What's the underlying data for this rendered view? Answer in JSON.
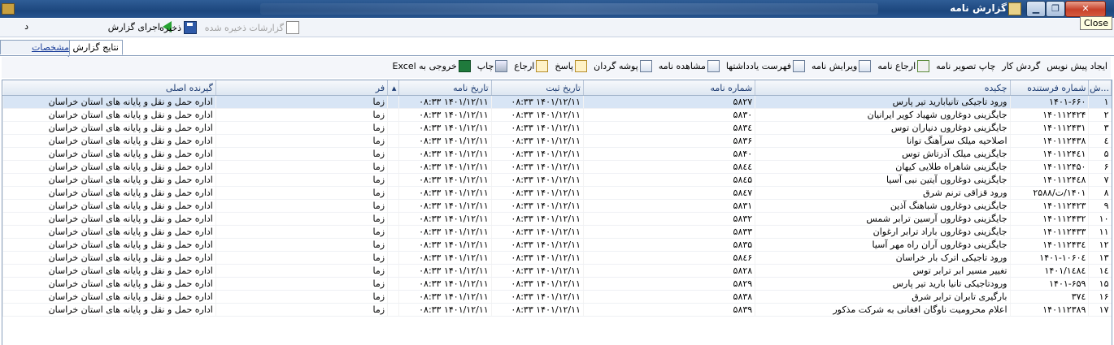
{
  "window": {
    "title": "گزارش نامه",
    "minimize": "▁",
    "maximize": "❐",
    "close": "✕",
    "close_tooltip": "Close"
  },
  "toolbar1": {
    "partial_left": "د",
    "run_report": "اجرای گزارش",
    "save": "ذخیره",
    "saved_reports": "گزارشات ذخیره شده"
  },
  "tabs": {
    "specs": "مشخصات گزارش",
    "results": "نتایج گزارش"
  },
  "actions": [
    {
      "label": "خروجی به Excel",
      "icon": "excel-icon"
    },
    {
      "label": "چاپ",
      "icon": "printer-icon"
    },
    {
      "label": "ارجاع",
      "icon": "mail-icon"
    },
    {
      "label": "پاسخ",
      "icon": "reply-mail-icon"
    },
    {
      "label": "پوشه گردان",
      "icon": "chart-icon"
    },
    {
      "label": "مشاهده نامه",
      "icon": "view-icon"
    },
    {
      "label": "فهرست یادداشتها",
      "icon": "list-icon"
    },
    {
      "label": "ویرایش نامه",
      "icon": "edit-icon"
    },
    {
      "label": "ارجاع نامه",
      "icon": "check-icon"
    },
    {
      "label": "چاپ تصویر نامه",
      "icon": ""
    },
    {
      "label": "گردش کار",
      "icon": ""
    },
    {
      "label": "ایجاد پیش نویس",
      "icon": ""
    }
  ],
  "columns": [
    "...ش",
    "شماره فرستنده",
    "چکیده",
    "شماره نامه",
    "تاریخ ثبت",
    "تاریخ نامه",
    "▴",
    "فر",
    "گیرنده اصلی"
  ],
  "rows": [
    {
      "n": "۱",
      "sender": "۱۴۰۱-۶۶۰",
      "summary": "ورود تاجیکی تانیابارید تیر پارس",
      "letter": "۵۸۲۷",
      "reg": "۱۴۰۱/۱۲/۱۱ ۰۸:۳۳",
      "date": "۱۴۰۱/۱۲/۱۱ ۰۸:۳۳",
      "fr": "زما",
      "recv": "اداره حمل و نقل و پایانه های استان خراسان"
    },
    {
      "n": "۲",
      "sender": "۱۴۰۱۱۲۴۲۴",
      "summary": "جایگزینی دوغاروں شهیاد کویر ایرانیان",
      "letter": "۵۸۳۰",
      "reg": "۱۴۰۱/۱۲/۱۱ ۰۸:۳۳",
      "date": "۱۴۰۱/۱۲/۱۱ ۰۸:۳۳",
      "fr": "زما",
      "recv": "اداره حمل و نقل و پایانه های استان خراسان"
    },
    {
      "n": "۳",
      "sender": "۱۴۰۱۱۲۴۳۱",
      "summary": "جایگزینی دوغاروں دنیاران توس",
      "letter": "۵۸۳٤",
      "reg": "۱۴۰۱/۱۲/۱۱ ۰۸:۳۳",
      "date": "۱۴۰۱/۱۲/۱۱ ۰۸:۳۳",
      "fr": "زما",
      "recv": "اداره حمل و نقل و پایانه های استان خراسان"
    },
    {
      "n": "٤",
      "sender": "۱۴۰۱۱۲۴۳۸",
      "summary": "اصلاحیه میلک سرآهنگ توانا",
      "letter": "۵۸۳۶",
      "reg": "۱۴۰۱/۱۲/۱۱ ۰۸:۳۳",
      "date": "۱۴۰۱/۱۲/۱۱ ۰۸:۳۳",
      "fr": "زما",
      "recv": "اداره حمل و نقل و پایانه های استان خراسان"
    },
    {
      "n": "۵",
      "sender": "۱۴۰۱۱۲۴٤۱",
      "summary": "جایگزینی میلک آذرتاش توس",
      "letter": "۵۸۴۰",
      "reg": "۱۴۰۱/۱۲/۱۱ ۰۸:۳۳",
      "date": "۱۴۰۱/۱۲/۱۱ ۰۸:۳۳",
      "fr": "زما",
      "recv": "اداره حمل و نقل و پایانه های استان خراسان"
    },
    {
      "n": "۶",
      "sender": "۱۴۰۱۱۲۴۵۰",
      "summary": "جایگزینی شاهراه طلایی کیهان",
      "letter": "۵۸٤٤",
      "reg": "۱۴۰۱/۱۲/۱۱ ۰۸:۳۳",
      "date": "۱۴۰۱/۱۲/۱۱ ۰۸:۳۳",
      "fr": "زما",
      "recv": "اداره حمل و نقل و پایانه های استان خراسان"
    },
    {
      "n": "۷",
      "sender": "۱۴۰۱۱۲۴٤۸",
      "summary": "جایگزینی دوغاروں آیتین نبی آسیا",
      "letter": "۵۸٤۵",
      "reg": "۱۴۰۱/۱۲/۱۱ ۰۸:۳۳",
      "date": "۱۴۰۱/۱۲/۱۱ ۰۸:۳۳",
      "fr": "زما",
      "recv": "اداره حمل و نقل و پایانه های استان خراسان"
    },
    {
      "n": "۸",
      "sender": "۱۴۰۱/ت/۲۵۸۸",
      "summary": "ورود قزاقی ترنم شرق",
      "letter": "۵۸٤۷",
      "reg": "۱۴۰۱/۱۲/۱۱ ۰۸:۳۳",
      "date": "۱۴۰۱/۱۲/۱۱ ۰۸:۳۳",
      "fr": "زما",
      "recv": "اداره حمل و نقل و پایانه های استان خراسان"
    },
    {
      "n": "۹",
      "sender": "۱۴۰۱۱۲۴۲۳",
      "summary": "جایگزینی دوغاروں شباهنگ آذین",
      "letter": "۵۸۳۱",
      "reg": "۱۴۰۱/۱۲/۱۱ ۰۸:۳۳",
      "date": "۱۴۰۱/۱۲/۱۱ ۰۸:۳۳",
      "fr": "زما",
      "recv": "اداره حمل و نقل و پایانه های استان خراسان"
    },
    {
      "n": "۱۰",
      "sender": "۱۴۰۱۱۲۴۳۲",
      "summary": "جایگزینی دوغاروں آرسین ترابر شمس",
      "letter": "۵۸۳۲",
      "reg": "۱۴۰۱/۱۲/۱۱ ۰۸:۳۳",
      "date": "۱۴۰۱/۱۲/۱۱ ۰۸:۳۳",
      "fr": "زما",
      "recv": "اداره حمل و نقل و پایانه های استان خراسان"
    },
    {
      "n": "۱۱",
      "sender": "۱۴۰۱۱۲۴۳۳",
      "summary": "جایگزینی دوغاروں باراد ترابر ارغوان",
      "letter": "۵۸۳۳",
      "reg": "۱۴۰۱/۱۲/۱۱ ۰۸:۳۳",
      "date": "۱۴۰۱/۱۲/۱۱ ۰۸:۳۳",
      "fr": "زما",
      "recv": "اداره حمل و نقل و پایانه های استان خراسان"
    },
    {
      "n": "۱۲",
      "sender": "۱۴۰۱۱۲۴۳٤",
      "summary": "جایگزینی دوغاروں آران راه مهر آسیا",
      "letter": "۵۸۳۵",
      "reg": "۱۴۰۱/۱۲/۱۱ ۰۸:۳۳",
      "date": "۱۴۰۱/۱۲/۱۱ ۰۸:۳۳",
      "fr": "زما",
      "recv": "اداره حمل و نقل و پایانه های استان خراسان"
    },
    {
      "n": "۱۳",
      "sender": "۱۴۰۱-۱۰۶۰٤",
      "summary": "ورود تاجیکی اترک بار خراسان",
      "letter": "۵۸٤۶",
      "reg": "۱۴۰۱/۱۲/۱۱ ۰۸:۳۳",
      "date": "۱۴۰۱/۱۲/۱۱ ۰۸:۳۳",
      "fr": "زما",
      "recv": "اداره حمل و نقل و پایانه های استان خراسان"
    },
    {
      "n": "۱٤",
      "sender": "۱۴۰۱/۱٤۸٤",
      "summary": "تغییر مسیر ابر ترابر توس",
      "letter": "۵۸۲۸",
      "reg": "۱۴۰۱/۱۲/۱۱ ۰۸:۳۳",
      "date": "۱۴۰۱/۱۲/۱۱ ۰۸:۳۳",
      "fr": "زما",
      "recv": "اداره حمل و نقل و پایانه های استان خراسان"
    },
    {
      "n": "۱۵",
      "sender": "۱۴۰۱-۶۵۹",
      "summary": "ورودتاجیکی تانیا بارید تیر پارس",
      "letter": "۵۸۲۹",
      "reg": "۱۴۰۱/۱۲/۱۱ ۰۸:۳۳",
      "date": "۱۴۰۱/۱۲/۱۱ ۰۸:۳۳",
      "fr": "زما",
      "recv": "اداره حمل و نقل و پایانه های استان خراسان"
    },
    {
      "n": "۱۶",
      "sender": "۳۷٤",
      "summary": "بارگیری تابران ترابر شرق",
      "letter": "۵۸۳۸",
      "reg": "۱۴۰۱/۱۲/۱۱ ۰۸:۳۳",
      "date": "۱۴۰۱/۱۲/۱۱ ۰۸:۳۳",
      "fr": "زما",
      "recv": "اداره حمل و نقل و پایانه های استان خراسان"
    },
    {
      "n": "۱۷",
      "sender": "۱۴۰۱۱۲۳۸۹",
      "summary": "اعلام محرومیت ناوگان افغانی به شرکت مذکور",
      "letter": "۵۸۳۹",
      "reg": "۱۴۰۱/۱۲/۱۱ ۰۸:۳۳",
      "date": "۱۴۰۱/۱۲/۱۱ ۰۸:۳۳",
      "fr": "زما",
      "recv": "اداره حمل و نقل و پایانه های استان خراسان"
    }
  ]
}
